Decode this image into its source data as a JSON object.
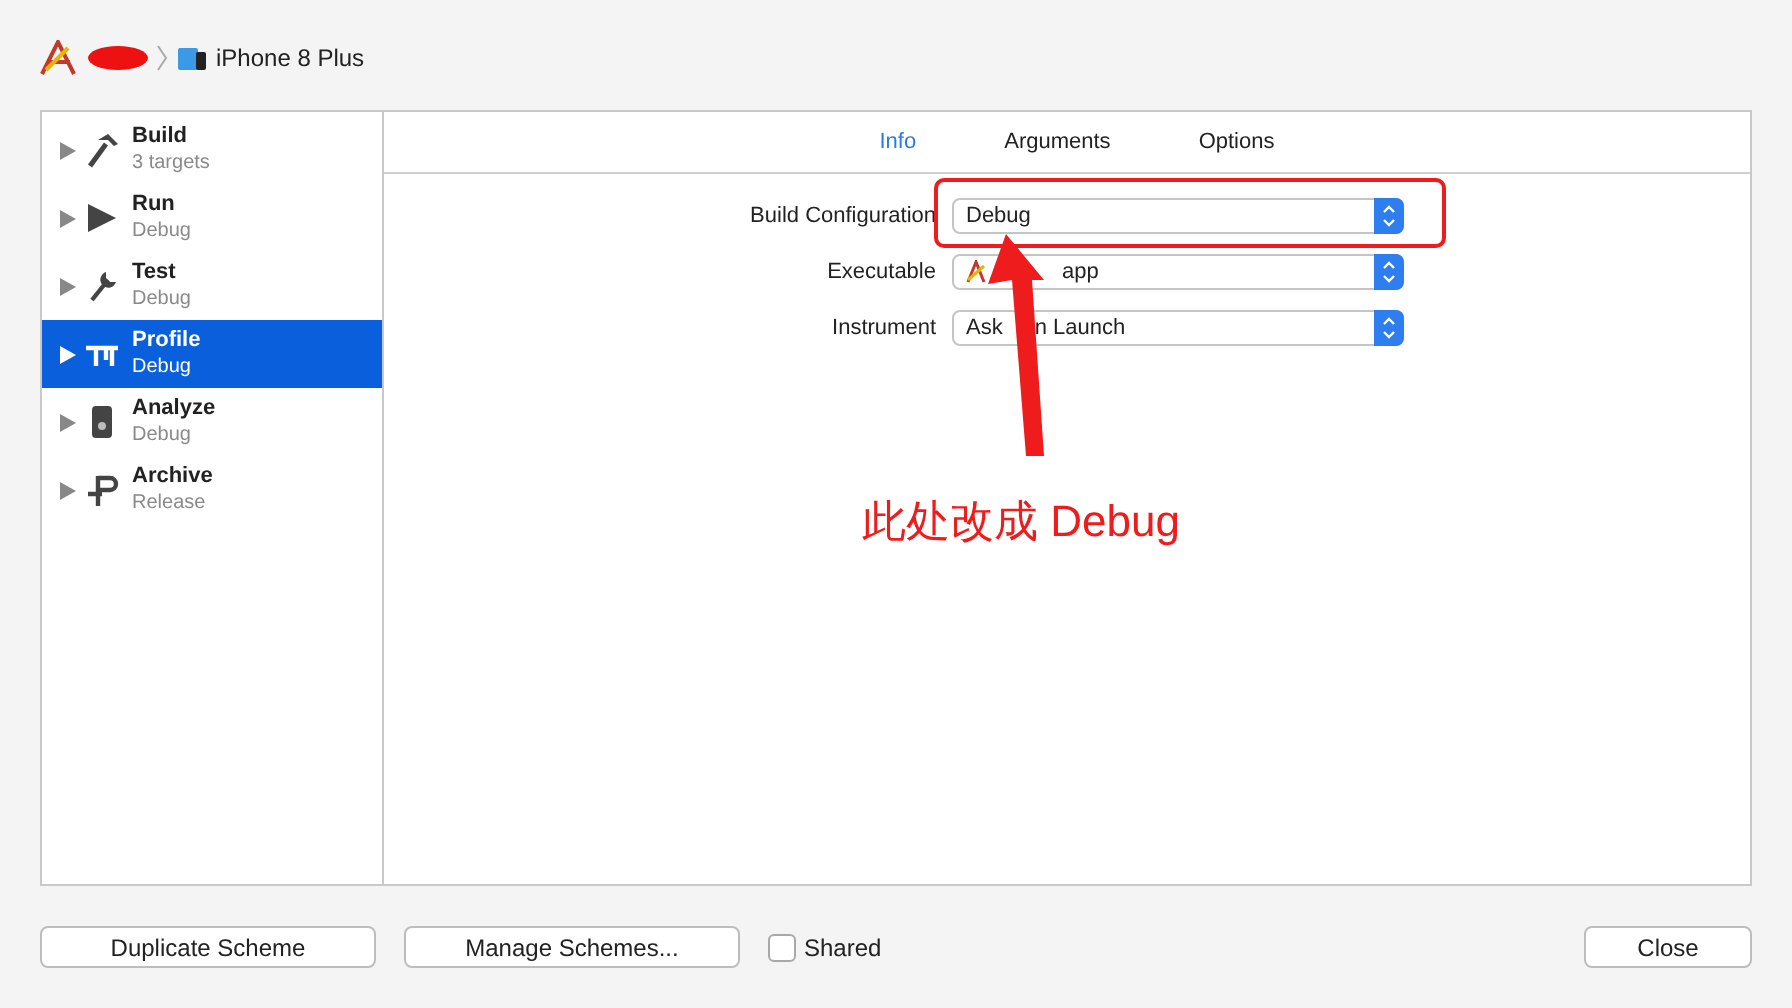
{
  "breadcrumb": {
    "device": "iPhone 8 Plus"
  },
  "sidebar": {
    "items": [
      {
        "kind": "build",
        "title": "Build",
        "subtitle": "3 targets",
        "selected": false
      },
      {
        "kind": "run",
        "title": "Run",
        "subtitle": "Debug",
        "selected": false
      },
      {
        "kind": "test",
        "title": "Test",
        "subtitle": "Debug",
        "selected": false
      },
      {
        "kind": "profile",
        "title": "Profile",
        "subtitle": "Debug",
        "selected": true
      },
      {
        "kind": "analyze",
        "title": "Analyze",
        "subtitle": "Debug",
        "selected": false
      },
      {
        "kind": "archive",
        "title": "Archive",
        "subtitle": "Release",
        "selected": false
      }
    ]
  },
  "tabs": [
    {
      "label": "Info",
      "selected": true
    },
    {
      "label": "Arguments",
      "selected": false
    },
    {
      "label": "Options",
      "selected": false
    }
  ],
  "form": [
    {
      "label": "Build Configuration",
      "value": [
        "Debug"
      ],
      "app_icon": false
    },
    {
      "label": "Executable",
      "value": [
        "app"
      ],
      "app_icon": true
    },
    {
      "label": "Instrument",
      "value": [
        "Ask",
        "n Launch"
      ],
      "app_icon": false
    }
  ],
  "annotation": {
    "text": "此处改成 Debug"
  },
  "footer": {
    "buttons": [
      "Duplicate Scheme",
      "Manage Schemes..."
    ],
    "shared": {
      "label": "Shared",
      "checked": false
    },
    "close": "Close"
  }
}
